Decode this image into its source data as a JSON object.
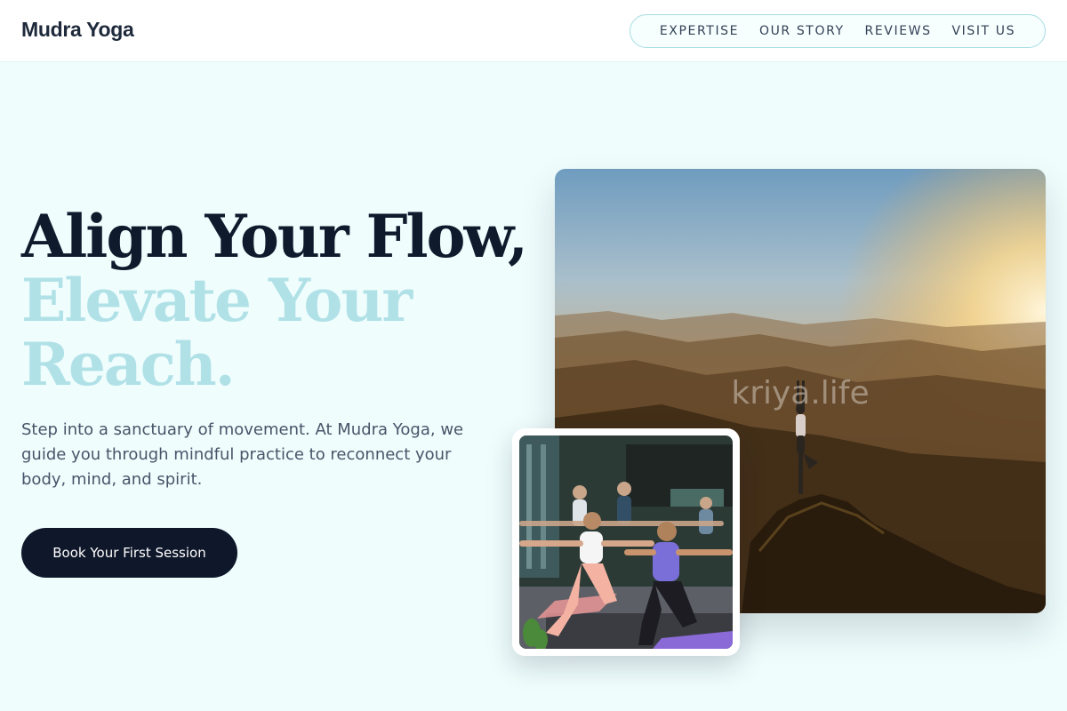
{
  "header": {
    "brand": "Mudra Yoga",
    "nav": [
      {
        "label": "EXPERTISE"
      },
      {
        "label": "OUR STORY"
      },
      {
        "label": "REVIEWS"
      },
      {
        "label": "VISIT US"
      }
    ]
  },
  "hero": {
    "headline_line1": "Align Your Flow,",
    "headline_line2": "Elevate Your",
    "headline_line3": "Reach.",
    "lede": "Step into a sanctuary of movement. At Mudra Yoga, we guide you through mindful practice to reconnect your body, mind, and spirit.",
    "cta_label": "Book Your First Session"
  },
  "media": {
    "main_photo_watermark": "kriya.life"
  },
  "colors": {
    "page_background": "#effdfd",
    "headline_dark": "#0f1b2d",
    "headline_accent": "#b0e1e7",
    "button_background": "#0f172a",
    "nav_border": "#a8dde3"
  }
}
